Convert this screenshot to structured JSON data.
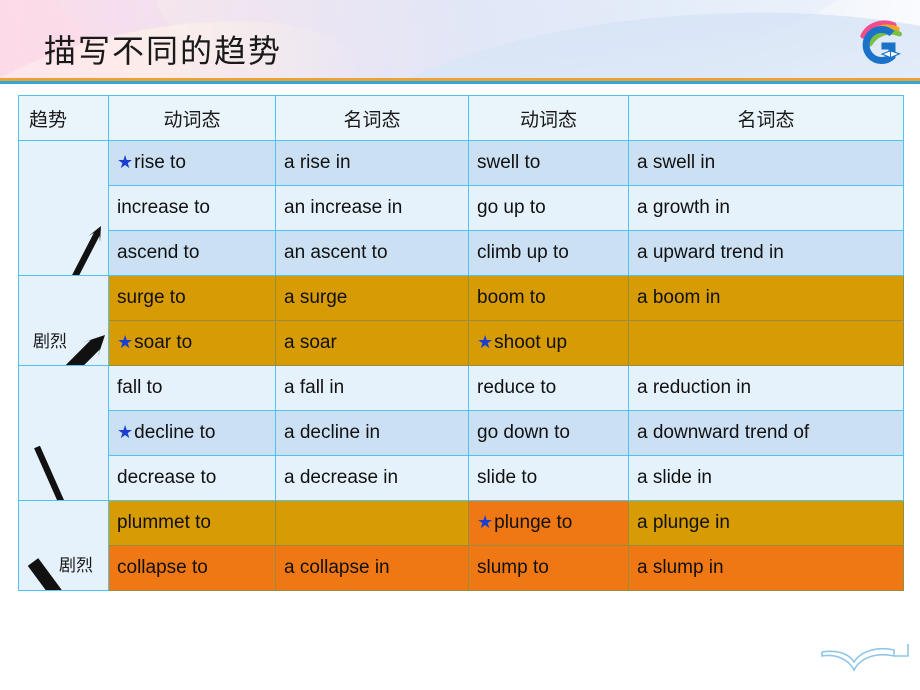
{
  "slide": {
    "title": "描写不同的趋势",
    "logo_name": "g-book-logo"
  },
  "table": {
    "headers": [
      "趋势",
      "动词态",
      "名词态",
      "动词态",
      "名词态"
    ],
    "sections": [
      {
        "id": "gradual-rise",
        "arrow": "thin-up-arrow",
        "intensity_label": "",
        "rows": [
          {
            "verb1": "rise to",
            "verb1_star": true,
            "noun1": "a rise in",
            "verb2": "swell to",
            "verb2_star": false,
            "noun2": "a swell in",
            "fill": "md"
          },
          {
            "verb1": "increase to",
            "verb1_star": false,
            "noun1": "an increase in",
            "verb2": "go up to",
            "verb2_star": false,
            "noun2": "a growth in",
            "fill": "lt"
          },
          {
            "verb1": "ascend to",
            "verb1_star": false,
            "noun1": "an ascent to",
            "verb2": "climb up to",
            "verb2_star": false,
            "noun2": "a upward trend in",
            "fill": "md"
          }
        ]
      },
      {
        "id": "sharp-rise",
        "arrow": "thick-up-arrow",
        "intensity_label": "剧烈",
        "rows": [
          {
            "verb1": "surge to",
            "verb1_star": false,
            "noun1": "a surge",
            "verb2": "boom to",
            "verb2_star": false,
            "noun2": "a boom in",
            "fill": "gold"
          },
          {
            "verb1": "soar to",
            "verb1_star": true,
            "noun1": "a soar",
            "verb2": "shoot up",
            "verb2_star": true,
            "noun2": "",
            "fill": "gold"
          }
        ]
      },
      {
        "id": "gradual-fall",
        "arrow": "thin-down-arrow",
        "intensity_label": "",
        "rows": [
          {
            "verb1": "fall to",
            "verb1_star": false,
            "noun1": "a fall in",
            "verb2": "reduce to",
            "verb2_star": false,
            "noun2": "a reduction in",
            "fill": "lt"
          },
          {
            "verb1": "decline to",
            "verb1_star": true,
            "noun1": "a decline in",
            "verb2": "go down to",
            "verb2_star": false,
            "noun2": "a downward trend of",
            "fill": "md"
          },
          {
            "verb1": "decrease to",
            "verb1_star": false,
            "noun1": "a decrease in",
            "verb2": "slide to",
            "verb2_star": false,
            "noun2": "a slide in",
            "fill": "lt"
          }
        ]
      },
      {
        "id": "sharp-fall",
        "arrow": "thick-down-arrow",
        "intensity_label": "剧烈",
        "rows": [
          {
            "verb1": "plummet to",
            "verb1_star": false,
            "noun1": "",
            "verb2": "plunge to",
            "verb2_star": true,
            "noun2": "a plunge in",
            "fill": "mixed-gold"
          },
          {
            "verb1": "collapse to",
            "verb1_star": false,
            "noun1": "a collapse in",
            "verb2": "slump to",
            "verb2_star": false,
            "noun2": "a slump in",
            "fill": "orange"
          }
        ]
      }
    ]
  },
  "colors": {
    "grid": "#4fc3f0",
    "light_row": "#e6f2fb",
    "medium_row": "#cbe0f2",
    "gold": "#d79b04",
    "orange": "#f07814",
    "star": "#1a3fd0",
    "rule_orange": "#f0a030",
    "rule_blue": "#2fa8dd"
  }
}
